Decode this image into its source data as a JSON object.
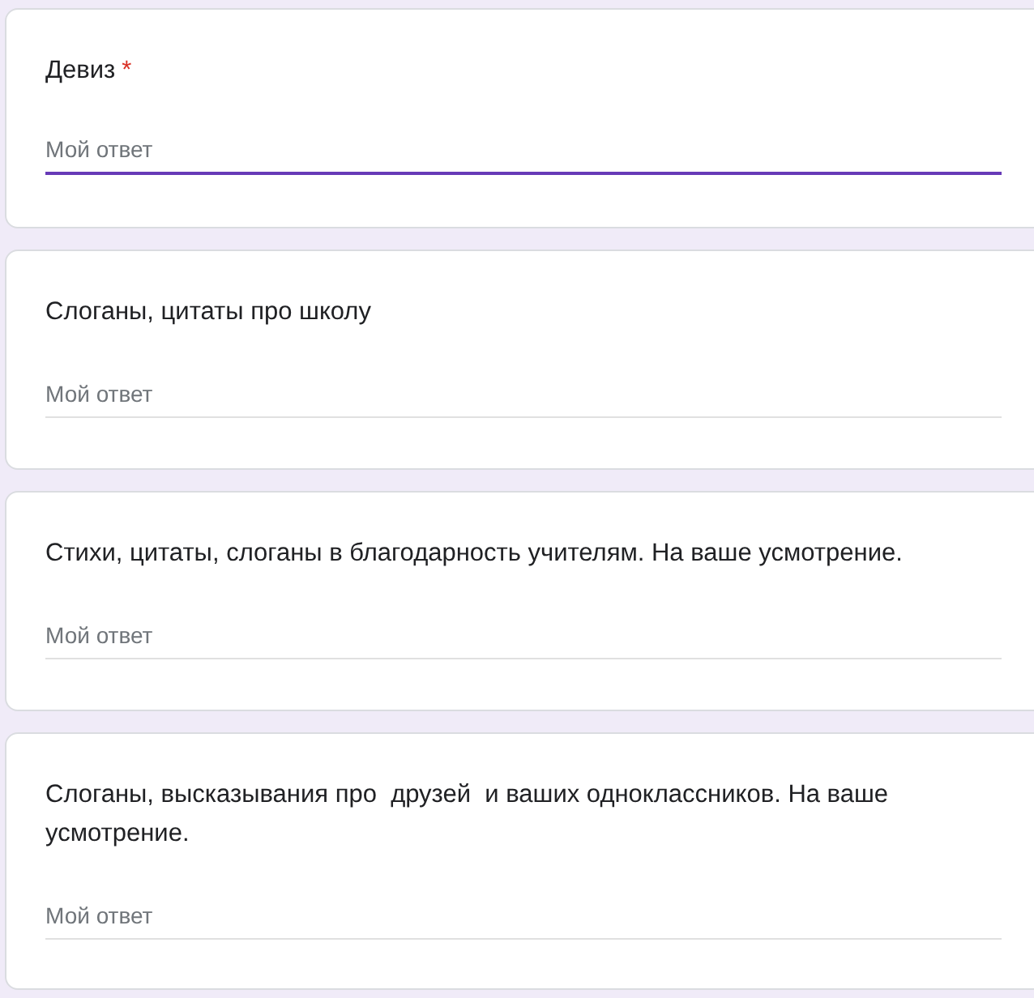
{
  "questions": [
    {
      "title": "Девиз",
      "required_mark": "*",
      "placeholder": "Мой ответ",
      "focused": true
    },
    {
      "title": "Слоганы, цитаты про школу",
      "placeholder": "Мой ответ",
      "focused": false
    },
    {
      "title": "Стихи, цитаты, слоганы в благодарность учителям. На ваше усмотрение.",
      "placeholder": "Мой ответ",
      "focused": false
    },
    {
      "title": "Слоганы, высказывания про  друзей  и ваших одноклассников. На ваше усмотрение.",
      "placeholder": "Мой ответ",
      "focused": false
    }
  ]
}
